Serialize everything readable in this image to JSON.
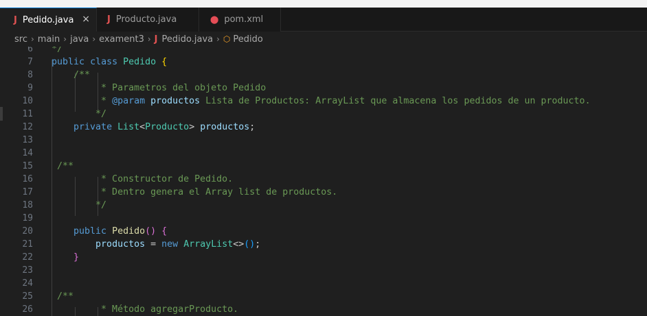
{
  "tabs": [
    {
      "label": "Pedido.java",
      "icon": "java-icon",
      "active": true,
      "close": "×"
    },
    {
      "label": "Producto.java",
      "icon": "java-icon",
      "active": false
    },
    {
      "label": "pom.xml",
      "icon": "xml-icon",
      "active": false
    }
  ],
  "breadcrumb": {
    "items": [
      "src",
      "main",
      "java",
      "exament3",
      "Pedido.java",
      "Pedido"
    ]
  },
  "editor": {
    "line_numbers": [
      "6",
      "7",
      "8",
      "9",
      "10",
      "11",
      "12",
      "13",
      "14",
      "15",
      "16",
      "17",
      "18",
      "19",
      "20",
      "21",
      "22",
      "23",
      "24",
      "25",
      "26"
    ],
    "lines": [
      [
        {
          "t": "*/",
          "c": "cm"
        }
      ],
      [
        {
          "t": "public",
          "c": "kw"
        },
        {
          "t": " "
        },
        {
          "t": "class",
          "c": "kw"
        },
        {
          "t": " "
        },
        {
          "t": "Pedido",
          "c": "ty"
        },
        {
          "t": " "
        },
        {
          "t": "{",
          "c": "br1"
        }
      ],
      [
        {
          "t": "    "
        },
        {
          "t": "/**",
          "c": "cm"
        }
      ],
      [
        {
          "t": "         * Parametros del objeto Pedido",
          "c": "cm"
        }
      ],
      [
        {
          "t": "         * ",
          "c": "cm"
        },
        {
          "t": "@param",
          "c": "tag"
        },
        {
          "t": " "
        },
        {
          "t": "productos",
          "c": "vr"
        },
        {
          "t": " Lista de Productos: ArrayList que almacena los pedidos de un producto.",
          "c": "cm"
        }
      ],
      [
        {
          "t": "        */",
          "c": "cm"
        }
      ],
      [
        {
          "t": "    "
        },
        {
          "t": "private",
          "c": "kw"
        },
        {
          "t": " "
        },
        {
          "t": "List",
          "c": "ty"
        },
        {
          "t": "<"
        },
        {
          "t": "Producto",
          "c": "ty"
        },
        {
          "t": "> "
        },
        {
          "t": "productos",
          "c": "vr"
        },
        {
          "t": ";"
        }
      ],
      [],
      [],
      [
        {
          "t": " "
        },
        {
          "t": "/**",
          "c": "cm"
        }
      ],
      [
        {
          "t": "         * Constructor de Pedido.",
          "c": "cm"
        }
      ],
      [
        {
          "t": "         * Dentro genera el Array list de productos.",
          "c": "cm"
        }
      ],
      [
        {
          "t": "        */",
          "c": "cm"
        }
      ],
      [],
      [
        {
          "t": "    "
        },
        {
          "t": "public",
          "c": "kw"
        },
        {
          "t": " "
        },
        {
          "t": "Pedido",
          "c": "fn"
        },
        {
          "t": "()",
          "c": "br2"
        },
        {
          "t": " "
        },
        {
          "t": "{",
          "c": "br2"
        }
      ],
      [
        {
          "t": "        "
        },
        {
          "t": "productos",
          "c": "vr"
        },
        {
          "t": " = "
        },
        {
          "t": "new",
          "c": "kw"
        },
        {
          "t": " "
        },
        {
          "t": "ArrayList",
          "c": "ty"
        },
        {
          "t": "<>"
        },
        {
          "t": "()",
          "c": "br3"
        },
        {
          "t": ";"
        }
      ],
      [
        {
          "t": "    "
        },
        {
          "t": "}",
          "c": "br2"
        }
      ],
      [],
      [],
      [
        {
          "t": " "
        },
        {
          "t": "/**",
          "c": "cm"
        }
      ],
      [
        {
          "t": "         * Método agregarProducto.",
          "c": "cm"
        }
      ]
    ]
  }
}
